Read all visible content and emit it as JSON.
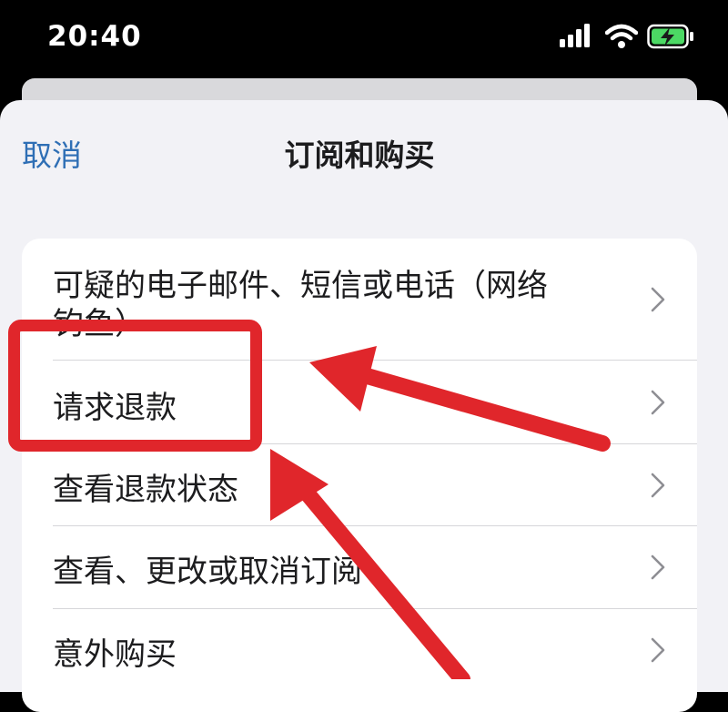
{
  "status_bar": {
    "time": "20:40",
    "icons": [
      "signal-icon",
      "wifi-icon",
      "battery-charging-icon"
    ]
  },
  "nav": {
    "cancel_label": "取消",
    "title": "订阅和购买"
  },
  "menu": {
    "items": [
      {
        "label": "可疑的电子邮件、短信或电话（网络",
        "label_line2": "钓鱼）",
        "icon": "chevron-right-icon"
      },
      {
        "label": "请求退款",
        "icon": "chevron-right-icon"
      },
      {
        "label": "查看退款状态",
        "icon": "chevron-right-icon"
      },
      {
        "label": "查看、更改或取消订阅",
        "icon": "chevron-right-icon"
      },
      {
        "label": "意外购买",
        "icon": "chevron-right-icon"
      }
    ]
  },
  "annotation": {
    "highlight_color": "#e0262b",
    "highlighted_item": "请求退款"
  },
  "colors": {
    "accent": "#2f6fb5",
    "sheet_background": "#f2f2f6",
    "card_background": "#ffffff"
  }
}
